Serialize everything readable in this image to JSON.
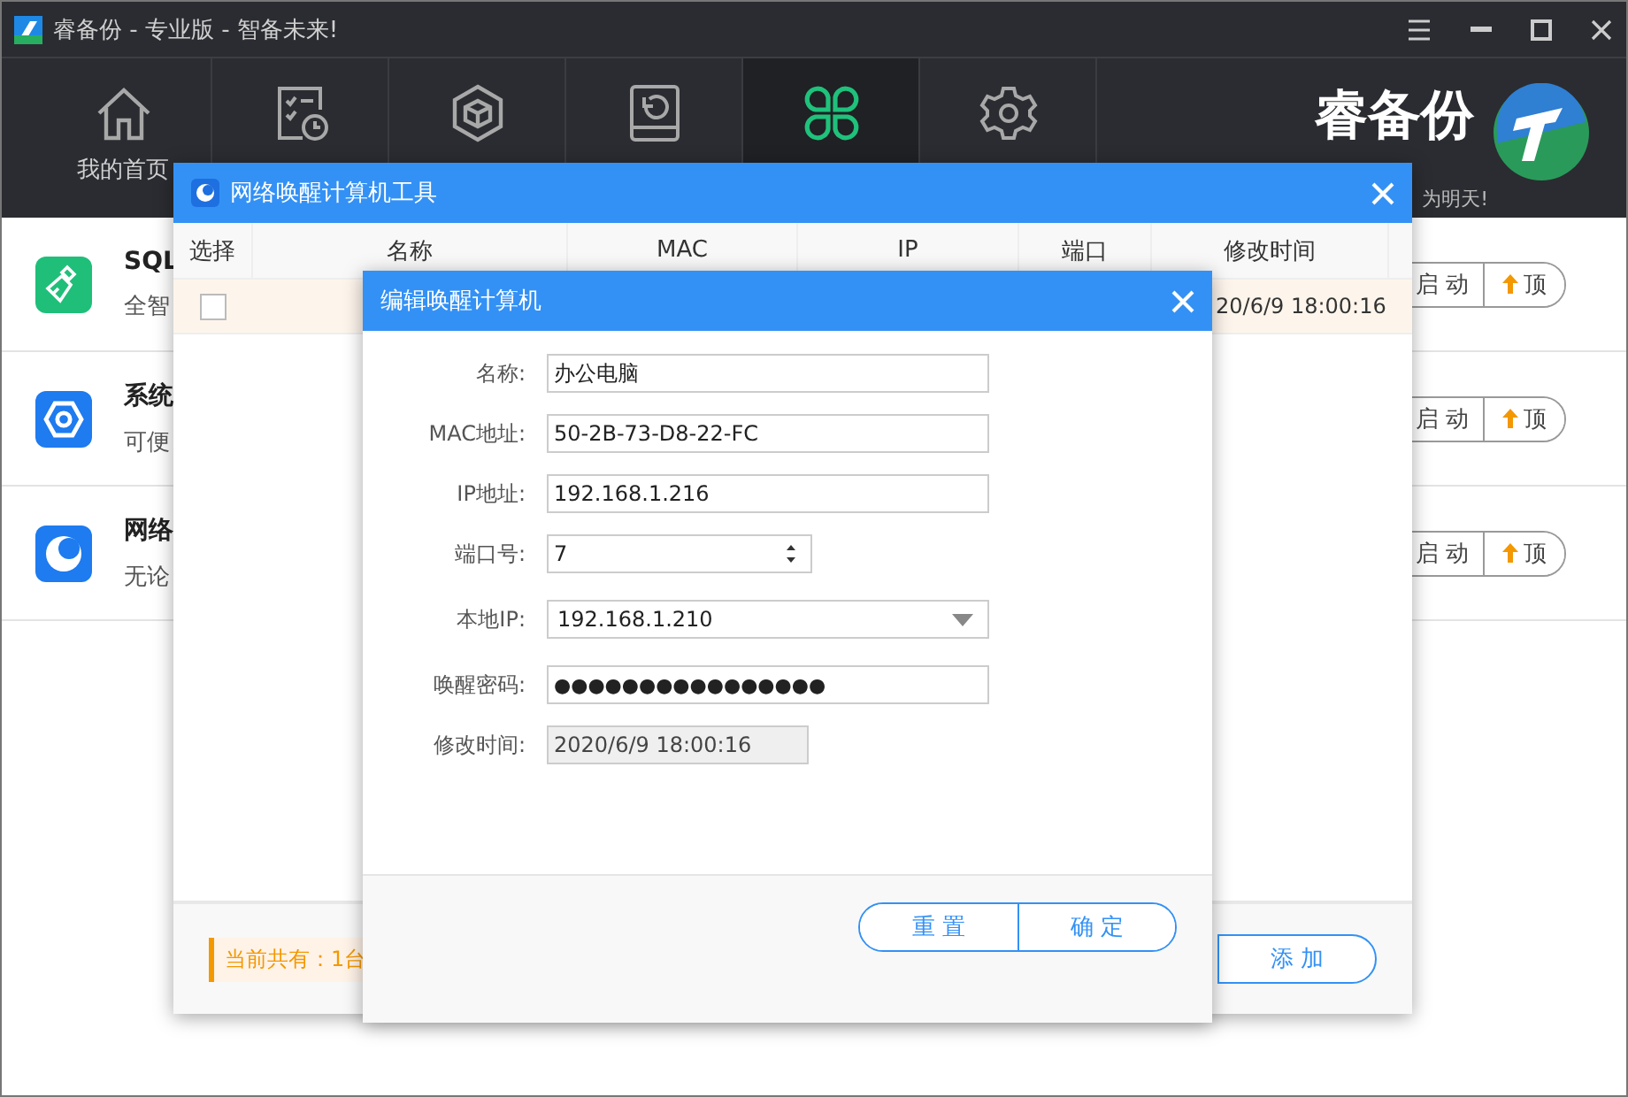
{
  "window": {
    "title": "睿备份 - 专业版 - 智备未来!"
  },
  "nav": {
    "tabs": [
      {
        "kind": "home",
        "label": "我的首页",
        "selected": false
      },
      {
        "kind": "schedule",
        "selected": false
      },
      {
        "kind": "box",
        "selected": false
      },
      {
        "kind": "restore",
        "selected": false
      },
      {
        "kind": "apps",
        "selected": true
      },
      {
        "kind": "settings",
        "selected": false
      }
    ]
  },
  "brand": {
    "name": "睿备份",
    "slogan": "为明天!"
  },
  "tools": [
    {
      "kind": "broom",
      "title": "SQL",
      "desc": "全智",
      "start": "启 动",
      "pin": "顶"
    },
    {
      "kind": "hex",
      "title": "系统",
      "desc": "可便",
      "start": "启 动",
      "pin": "顶"
    },
    {
      "kind": "moon",
      "title": "网络",
      "desc": "无论",
      "start": "启 动",
      "pin": "顶"
    }
  ],
  "wol_dialog": {
    "title": "网络唤醒计算机工具",
    "columns": [
      "选择",
      "名称",
      "MAC",
      "IP",
      "端口",
      "修改时间"
    ],
    "rows": [
      {
        "checked": false,
        "modified": "20/6/9 18:00:16"
      }
    ],
    "count": "当前共有：1台",
    "add_button": "添 加"
  },
  "edit_dialog": {
    "title": "编辑唤醒计算机",
    "fields": [
      {
        "kind": "text",
        "label": "名称:",
        "value": "办公电脑"
      },
      {
        "kind": "text",
        "label": "MAC地址:",
        "value": "50-2B-73-D8-22-FC"
      },
      {
        "kind": "text",
        "label": "IP地址:",
        "value": "192.168.1.216"
      },
      {
        "kind": "spin",
        "label": "端口号:",
        "value": "7"
      },
      {
        "kind": "select",
        "label": "本地IP:",
        "value": "192.168.1.210"
      },
      {
        "kind": "password",
        "label": "唤醒密码:",
        "value": "●●●●●●●●●●●●●●●●"
      },
      {
        "kind": "disabled",
        "label": "修改时间:",
        "value": "2020/6/9 18:00:16"
      }
    ],
    "buttons": [
      "重 置",
      "确 定"
    ]
  }
}
